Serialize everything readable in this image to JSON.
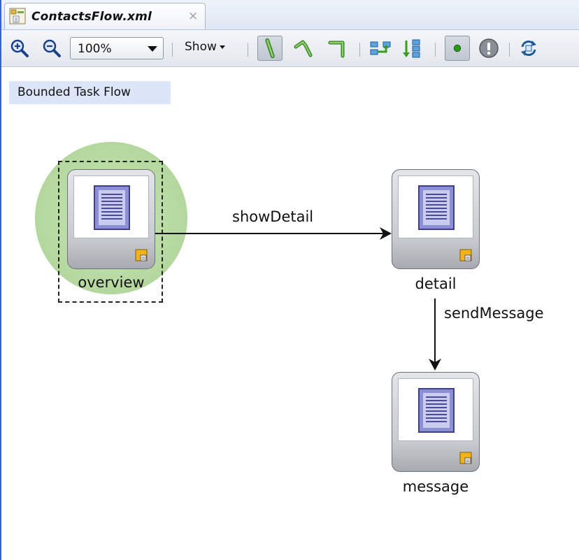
{
  "editor": {
    "tab_title": "ContactsFlow.xml",
    "tab_close": "×",
    "tab_icon": "xml-file-icon"
  },
  "toolbar": {
    "zoom_in_icon": "zoom-in-icon",
    "zoom_out_icon": "zoom-out-icon",
    "zoom_value": "100%",
    "show_label": "Show",
    "tools": [
      "straight-line-icon",
      "polyline-icon",
      "orthogonal-line-icon",
      "align-horizontal-icon",
      "align-vertical-icon",
      "default-activity-icon",
      "warning-icon",
      "refresh-icon"
    ]
  },
  "canvas": {
    "flow_type_label": "Bounded Task Flow",
    "nodes": [
      {
        "id": "overview",
        "label": "overview",
        "is_default": true,
        "selected": true
      },
      {
        "id": "detail",
        "label": "detail",
        "is_default": false,
        "selected": false
      },
      {
        "id": "message",
        "label": "message",
        "is_default": false,
        "selected": false
      }
    ],
    "edges": [
      {
        "from": "overview",
        "to": "detail",
        "label": "showDetail"
      },
      {
        "from": "detail",
        "to": "message",
        "label": "sendMessage"
      }
    ]
  },
  "colors": {
    "frame_accent": "#3b5fcf",
    "label_bg": "#dce6f8",
    "start_halo": "#b8dba3",
    "doc_fill": "#8c8fd6",
    "badge": "#f2b21a"
  }
}
